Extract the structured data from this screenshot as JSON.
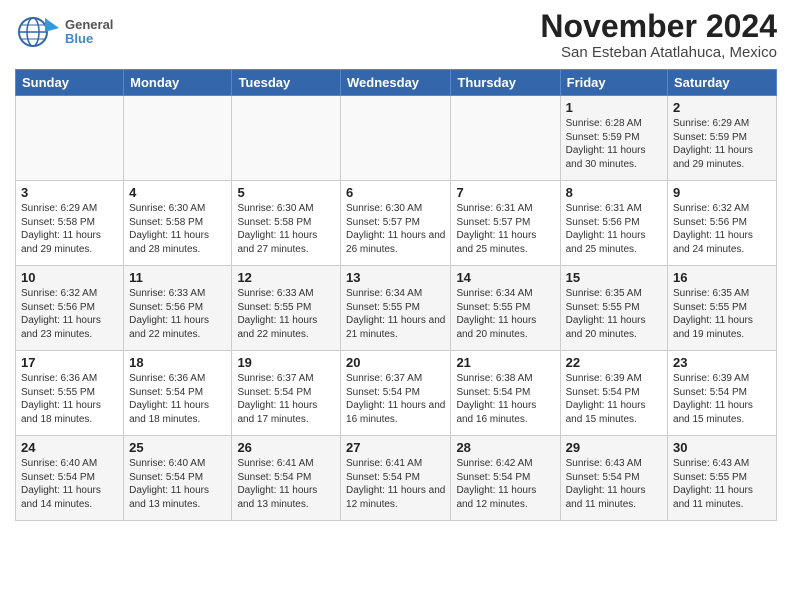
{
  "header": {
    "logo_general": "General",
    "logo_blue": "Blue",
    "month_title": "November 2024",
    "location": "San Esteban Atatlahuca, Mexico"
  },
  "weekdays": [
    "Sunday",
    "Monday",
    "Tuesday",
    "Wednesday",
    "Thursday",
    "Friday",
    "Saturday"
  ],
  "weeks": [
    [
      {
        "day": "",
        "info": ""
      },
      {
        "day": "",
        "info": ""
      },
      {
        "day": "",
        "info": ""
      },
      {
        "day": "",
        "info": ""
      },
      {
        "day": "",
        "info": ""
      },
      {
        "day": "1",
        "info": "Sunrise: 6:28 AM\nSunset: 5:59 PM\nDaylight: 11 hours and 30 minutes."
      },
      {
        "day": "2",
        "info": "Sunrise: 6:29 AM\nSunset: 5:59 PM\nDaylight: 11 hours and 29 minutes."
      }
    ],
    [
      {
        "day": "3",
        "info": "Sunrise: 6:29 AM\nSunset: 5:58 PM\nDaylight: 11 hours and 29 minutes."
      },
      {
        "day": "4",
        "info": "Sunrise: 6:30 AM\nSunset: 5:58 PM\nDaylight: 11 hours and 28 minutes."
      },
      {
        "day": "5",
        "info": "Sunrise: 6:30 AM\nSunset: 5:58 PM\nDaylight: 11 hours and 27 minutes."
      },
      {
        "day": "6",
        "info": "Sunrise: 6:30 AM\nSunset: 5:57 PM\nDaylight: 11 hours and 26 minutes."
      },
      {
        "day": "7",
        "info": "Sunrise: 6:31 AM\nSunset: 5:57 PM\nDaylight: 11 hours and 25 minutes."
      },
      {
        "day": "8",
        "info": "Sunrise: 6:31 AM\nSunset: 5:56 PM\nDaylight: 11 hours and 25 minutes."
      },
      {
        "day": "9",
        "info": "Sunrise: 6:32 AM\nSunset: 5:56 PM\nDaylight: 11 hours and 24 minutes."
      }
    ],
    [
      {
        "day": "10",
        "info": "Sunrise: 6:32 AM\nSunset: 5:56 PM\nDaylight: 11 hours and 23 minutes."
      },
      {
        "day": "11",
        "info": "Sunrise: 6:33 AM\nSunset: 5:56 PM\nDaylight: 11 hours and 22 minutes."
      },
      {
        "day": "12",
        "info": "Sunrise: 6:33 AM\nSunset: 5:55 PM\nDaylight: 11 hours and 22 minutes."
      },
      {
        "day": "13",
        "info": "Sunrise: 6:34 AM\nSunset: 5:55 PM\nDaylight: 11 hours and 21 minutes."
      },
      {
        "day": "14",
        "info": "Sunrise: 6:34 AM\nSunset: 5:55 PM\nDaylight: 11 hours and 20 minutes."
      },
      {
        "day": "15",
        "info": "Sunrise: 6:35 AM\nSunset: 5:55 PM\nDaylight: 11 hours and 20 minutes."
      },
      {
        "day": "16",
        "info": "Sunrise: 6:35 AM\nSunset: 5:55 PM\nDaylight: 11 hours and 19 minutes."
      }
    ],
    [
      {
        "day": "17",
        "info": "Sunrise: 6:36 AM\nSunset: 5:55 PM\nDaylight: 11 hours and 18 minutes."
      },
      {
        "day": "18",
        "info": "Sunrise: 6:36 AM\nSunset: 5:54 PM\nDaylight: 11 hours and 18 minutes."
      },
      {
        "day": "19",
        "info": "Sunrise: 6:37 AM\nSunset: 5:54 PM\nDaylight: 11 hours and 17 minutes."
      },
      {
        "day": "20",
        "info": "Sunrise: 6:37 AM\nSunset: 5:54 PM\nDaylight: 11 hours and 16 minutes."
      },
      {
        "day": "21",
        "info": "Sunrise: 6:38 AM\nSunset: 5:54 PM\nDaylight: 11 hours and 16 minutes."
      },
      {
        "day": "22",
        "info": "Sunrise: 6:39 AM\nSunset: 5:54 PM\nDaylight: 11 hours and 15 minutes."
      },
      {
        "day": "23",
        "info": "Sunrise: 6:39 AM\nSunset: 5:54 PM\nDaylight: 11 hours and 15 minutes."
      }
    ],
    [
      {
        "day": "24",
        "info": "Sunrise: 6:40 AM\nSunset: 5:54 PM\nDaylight: 11 hours and 14 minutes."
      },
      {
        "day": "25",
        "info": "Sunrise: 6:40 AM\nSunset: 5:54 PM\nDaylight: 11 hours and 13 minutes."
      },
      {
        "day": "26",
        "info": "Sunrise: 6:41 AM\nSunset: 5:54 PM\nDaylight: 11 hours and 13 minutes."
      },
      {
        "day": "27",
        "info": "Sunrise: 6:41 AM\nSunset: 5:54 PM\nDaylight: 11 hours and 12 minutes."
      },
      {
        "day": "28",
        "info": "Sunrise: 6:42 AM\nSunset: 5:54 PM\nDaylight: 11 hours and 12 minutes."
      },
      {
        "day": "29",
        "info": "Sunrise: 6:43 AM\nSunset: 5:54 PM\nDaylight: 11 hours and 11 minutes."
      },
      {
        "day": "30",
        "info": "Sunrise: 6:43 AM\nSunset: 5:55 PM\nDaylight: 11 hours and 11 minutes."
      }
    ]
  ]
}
